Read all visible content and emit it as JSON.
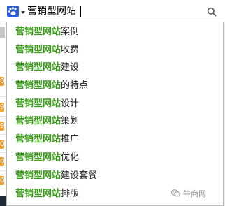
{
  "search": {
    "query": "营销型网站",
    "engine_icon": "baidu-paw-icon",
    "search_icon": "magnifier-icon"
  },
  "suggestions": [
    {
      "highlight": "营销型网站",
      "rest": "案例"
    },
    {
      "highlight": "营销型网站",
      "rest": "收费"
    },
    {
      "highlight": "营销型网站",
      "rest": "建设"
    },
    {
      "highlight": "营销型网站",
      "rest": "的特点"
    },
    {
      "highlight": "营销型网站",
      "rest": "设计"
    },
    {
      "highlight": "营销型网站",
      "rest": "策划"
    },
    {
      "highlight": "营销型网站",
      "rest": "推广"
    },
    {
      "highlight": "营销型网站",
      "rest": "优化"
    },
    {
      "highlight": "营销型网站",
      "rest": "建设套餐"
    },
    {
      "highlight": "营销型网站",
      "rest": "排版"
    }
  ],
  "background_badges": [
    "0",
    "9",
    "9",
    "0",
    "0",
    "0"
  ],
  "watermark": {
    "text": "牛商网",
    "icon": "wechat-icon"
  },
  "colors": {
    "highlight": "#3a9a1a",
    "engine_blue": "#2a5cd8",
    "badge": "#f0a030"
  }
}
